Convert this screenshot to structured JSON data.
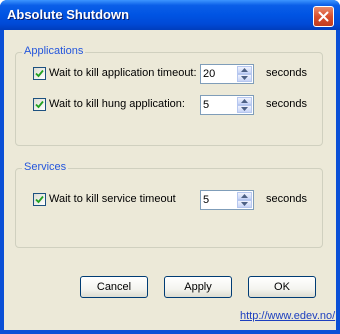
{
  "window": {
    "title": "Absolute Shutdown",
    "close_icon": "close-icon"
  },
  "applications": {
    "legend": "Applications",
    "kill_app_timeout": {
      "label": "Wait to kill application timeout:",
      "checked": true,
      "value": "20",
      "unit": "seconds"
    },
    "kill_hung_app": {
      "label": "Wait to kill hung application:",
      "checked": true,
      "value": "5",
      "unit": "seconds"
    }
  },
  "services": {
    "legend": "Services",
    "kill_service_timeout": {
      "label": "Wait to kill service timeout",
      "checked": true,
      "value": "5",
      "unit": "seconds"
    }
  },
  "buttons": {
    "cancel": "Cancel",
    "apply": "Apply",
    "ok": "OK"
  },
  "link": "http://www.edev.no/",
  "colors": {
    "title_bar": "#0054e3",
    "dialog_bg": "#ece9d8",
    "legend_text": "#2456dc",
    "close_button": "#d94f2e"
  }
}
